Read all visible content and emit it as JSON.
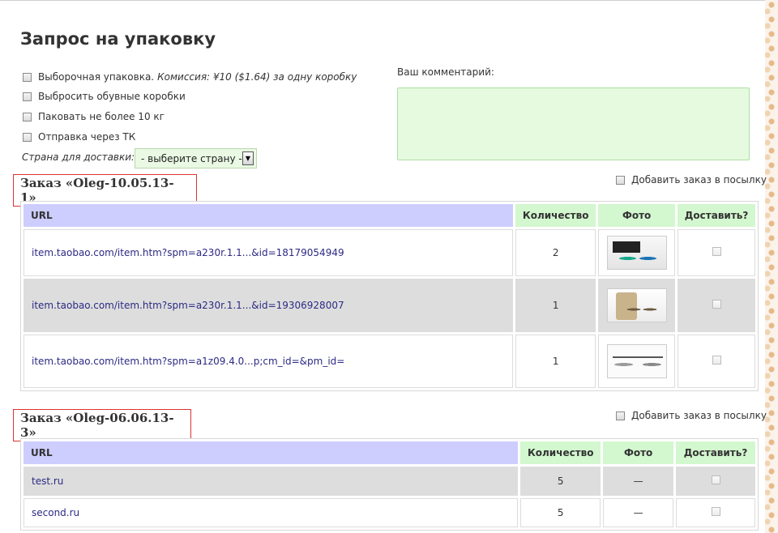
{
  "page": {
    "title": "Запрос на упаковку"
  },
  "options": [
    {
      "label": "Выборочная упаковка.",
      "note": "Комиссия: ¥10 ($1.64) за одну коробку"
    },
    {
      "label": "Выбросить обувные коробки"
    },
    {
      "label": "Паковать не более 10 кг"
    },
    {
      "label": "Отправка через ТК"
    }
  ],
  "country": {
    "label": "Страна для доставки:",
    "selected": "- выберите страну -"
  },
  "comment": {
    "label": "Ваш комментарий:",
    "value": ""
  },
  "columns": {
    "url": "URL",
    "qty": "Количество",
    "photo": "Фото",
    "deliver": "Доставить?"
  },
  "add_to_parcel_label": "Добавить заказ в посылку",
  "orders": [
    {
      "title": "Заказ «Oleg-10.05.13-1»",
      "rows": [
        {
          "url": "item.taobao.com/item.htm?spm=a230r.1.1...&id=18179054949",
          "qty": "2",
          "photo": "sunglasses-photo"
        },
        {
          "url": "item.taobao.com/item.htm?spm=a230r.1.1...&id=19306928007",
          "qty": "1",
          "photo": "sunglasses-photo"
        },
        {
          "url": "item.taobao.com/item.htm?spm=a1z09.4.0...p;cm_id=&pm_id=",
          "qty": "1",
          "photo": "sunglasses-photo"
        }
      ]
    },
    {
      "title": "Заказ «Oleg-06.06.13-3»",
      "rows": [
        {
          "url": "test.ru",
          "qty": "5",
          "photo": "—"
        },
        {
          "url": "second.ru",
          "qty": "5",
          "photo": "—"
        }
      ]
    }
  ],
  "colors": {
    "url_header": "#cdcdfe",
    "header": "#d3f7cf",
    "input_bg": "#e6fae0",
    "order_border": "#dd3333",
    "link": "#2c2a84"
  }
}
